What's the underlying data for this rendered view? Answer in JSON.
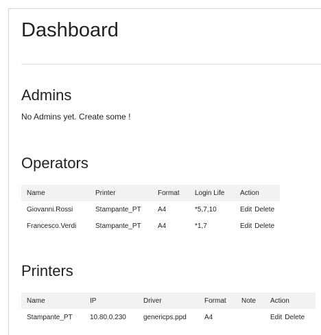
{
  "page": {
    "title": "Dashboard"
  },
  "admins": {
    "heading": "Admins",
    "empty_message": "No Admins yet. Create some !"
  },
  "operators": {
    "heading": "Operators",
    "columns": [
      "Name",
      "Printer",
      "Format",
      "Login Life",
      "Action"
    ],
    "rows": [
      {
        "name": "Giovanni.Rossi",
        "printer": "Stampante_PT",
        "format": "A4",
        "login_life": "*5,7,10",
        "edit": "Edit",
        "delete": "Delete"
      },
      {
        "name": "Francesco.Verdi",
        "printer": "Stampante_PT",
        "format": "A4",
        "login_life": "*1,7",
        "edit": "Edit",
        "delete": "Delete"
      }
    ]
  },
  "printers": {
    "heading": "Printers",
    "columns": [
      "Name",
      "IP",
      "Driver",
      "Format",
      "Note",
      "Action"
    ],
    "rows": [
      {
        "name": "Stampante_PT",
        "ip": "10.80.0.230",
        "driver": "genericps.ppd",
        "format": "A4",
        "note": "",
        "edit": "Edit",
        "delete": "Delete"
      }
    ]
  }
}
